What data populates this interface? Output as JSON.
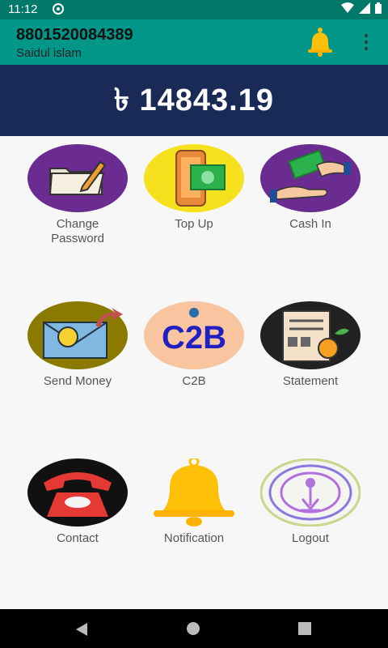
{
  "status": {
    "time": "11:12"
  },
  "header": {
    "phone": "8801520084389",
    "name": "Saidul islam"
  },
  "balance": {
    "amount": "৳ 14843.19"
  },
  "menu": [
    {
      "label": "Change\nPassword"
    },
    {
      "label": "Top Up"
    },
    {
      "label": "Cash In"
    },
    {
      "label": "Send Money"
    },
    {
      "label": "C2B"
    },
    {
      "label": "Statement"
    },
    {
      "label": "Contact"
    },
    {
      "label": "Notification"
    },
    {
      "label": "Logout"
    }
  ],
  "icons": {
    "c2b_text": "C2B"
  },
  "colors": {
    "statusbar": "#00796b",
    "appbar": "#009688",
    "balance_bg": "#192a56",
    "purple": "#6a2c91",
    "yellow": "#f5e11e",
    "olive": "#8a7a00",
    "peach": "#f8c5a0",
    "dark": "#222222",
    "bell": "#ffc107"
  }
}
